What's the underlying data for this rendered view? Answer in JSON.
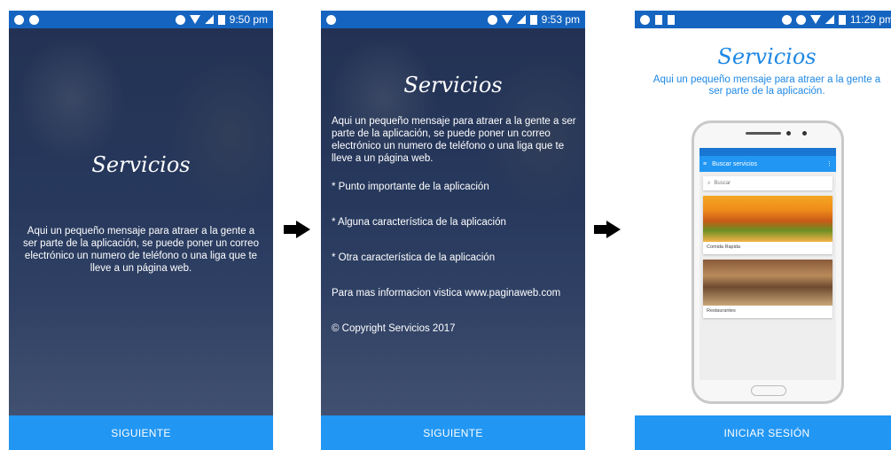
{
  "screen1": {
    "status_time": "9:50 pm",
    "title": "Servicios",
    "message": "Aqui un pequeño mensaje para atraer a la gente a ser parte de la aplicación, se puede poner un correo electrónico un numero de teléfono o una liga que te lleve a un página web.",
    "button": "SIGUIENTE"
  },
  "screen2": {
    "status_time": "9:53 pm",
    "title": "Servicios",
    "message": "Aqui un pequeño mensaje para atraer a la gente a ser parte de la aplicación, se puede poner un correo electrónico un numero de teléfono o una liga que te lleve a un página web.",
    "bullets": [
      "* Punto importante de la aplicación",
      "* Alguna característica de la aplicación",
      "* Otra característica de la aplicación"
    ],
    "info": "Para mas informacion vistica www.paginaweb.com",
    "copyright": "© Copyright Servicios 2017",
    "button": "SIGUIENTE"
  },
  "screen3": {
    "status_time": "11:29 pm",
    "title": "Servicios",
    "message": "Aqui un pequeño mensaje para atraer a la gente a ser parte de la aplicación.",
    "mockup": {
      "toolbar_title": "Buscar servicios",
      "search_placeholder": "Buscar",
      "cards": [
        {
          "title": "Comida Rapida"
        },
        {
          "title": "Restaurantes"
        }
      ]
    },
    "button": "INICIAR SESIÓN"
  },
  "colors": {
    "status_bar": "#1565c0",
    "button": "#2196f3",
    "accent_text": "#1e88e5"
  },
  "icons": [
    "arrow-right-icon",
    "headphones-icon",
    "wifi-icon",
    "signal-icon",
    "battery-icon",
    "menu-icon",
    "search-icon",
    "more-vert-icon"
  ]
}
